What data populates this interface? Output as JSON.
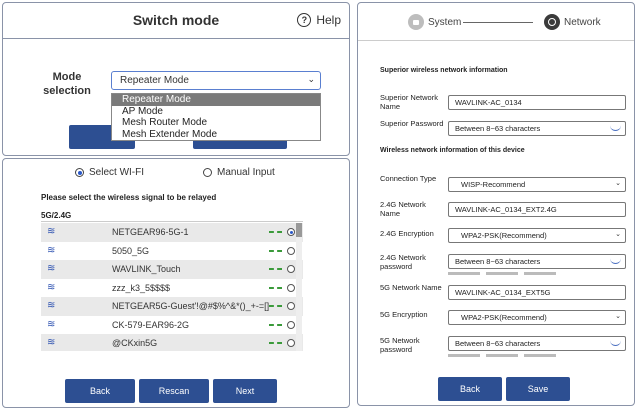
{
  "switch_mode": {
    "title": "Switch mode",
    "help_label": "Help",
    "mode_label": "Mode selection",
    "selected_value": "Repeater Mode",
    "options": [
      "Repeater Mode",
      "AP Mode",
      "Mesh Router Mode",
      "Mesh Extender Mode"
    ]
  },
  "wifi_select": {
    "radio_options": [
      "Select WI-FI",
      "Manual Input"
    ],
    "selected_radio": "Select WI-FI",
    "instruction": "Please select the wireless signal to be relayed",
    "band": "5G/2.4G",
    "networks": [
      {
        "ssid": "NETGEAR96-5G-1",
        "selected": true
      },
      {
        "ssid": "5050_5G",
        "selected": false
      },
      {
        "ssid": "WAVLINK_Touch",
        "selected": false
      },
      {
        "ssid": "zzz_k3_5$$$$",
        "selected": false
      },
      {
        "ssid": "NETGEAR5G-Guest'!@#$%^&*()_+-=[]",
        "selected": false
      },
      {
        "ssid": "CK-579-EAR96-2G",
        "selected": false
      },
      {
        "ssid": "@CKxin5G",
        "selected": false
      }
    ],
    "buttons": {
      "back": "Back",
      "rescan": "Rescan",
      "next": "Next"
    }
  },
  "network_form": {
    "steps": {
      "system": "System",
      "network": "Network"
    },
    "superior_section": "Superior wireless network information",
    "superior_name_label": "Superior Network Name",
    "superior_name_value": "WAVLINK-AC_0134",
    "superior_password_label": "Superior Password",
    "superior_password_placeholder": "Between 8~63 characters",
    "device_section": "Wireless network information of this device",
    "connection_type_label": "Connection Type",
    "connection_type_value": "WISP-Recommend",
    "g24_name_label": "2.4G Network Name",
    "g24_name_value": "WAVLINK-AC_0134_EXT2.4G",
    "g24_enc_label": "2.4G Encryption",
    "g24_enc_value": "WPA2-PSK(Recommend)",
    "g24_pass_label": "2.4G Network password",
    "g24_pass_placeholder": "Between 8~63 characters",
    "g5_name_label": "5G Network Name",
    "g5_name_value": "WAVLINK-AC_0134_EXT5G",
    "g5_enc_label": "5G Encryption",
    "g5_enc_value": "WPA2-PSK(Recommend)",
    "g5_pass_label": "5G Network password",
    "g5_pass_placeholder": "Between 8~63 characters",
    "back_label": "Back",
    "save_label": "Save"
  }
}
